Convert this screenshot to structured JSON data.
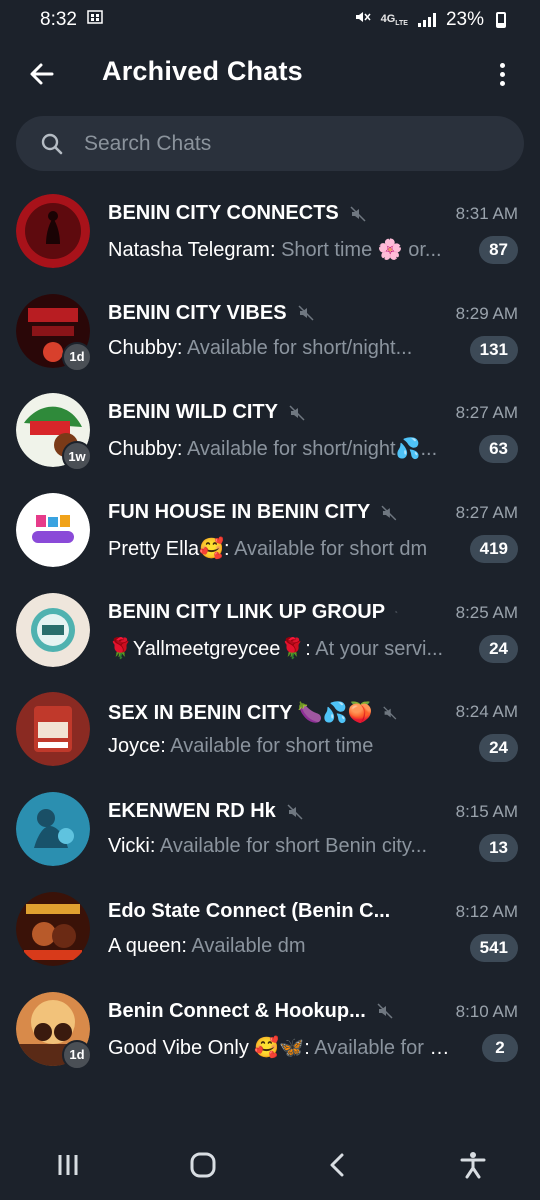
{
  "status_bar": {
    "time": "8:32",
    "network": "4G LTE",
    "battery": "23%"
  },
  "appbar": {
    "title": "Archived Chats",
    "back_icon": "arrow-left-icon",
    "menu_icon": "more-vertical-icon"
  },
  "search": {
    "placeholder": "Search Chats",
    "value": ""
  },
  "colors": {
    "background": "#1c222b",
    "search_bg": "#2a313c",
    "badge_bg": "#3d4a57",
    "muted_text": "#8b949e"
  },
  "chats": [
    {
      "name": "BENIN CITY CONNECTS",
      "time": "8:31 AM",
      "sender": "Natasha Telegram: ",
      "message": "Short time 🌸 or...",
      "count": "87",
      "avatar_badge": ""
    },
    {
      "name": "BENIN CITY VIBES",
      "time": "8:29 AM",
      "sender": "Chubby: ",
      "message": "Available for short/night...",
      "count": "131",
      "avatar_badge": "1d"
    },
    {
      "name": "BENIN WILD CITY",
      "time": "8:27 AM",
      "sender": "Chubby: ",
      "message": "Available for short/night💦...",
      "count": "63",
      "avatar_badge": "1w"
    },
    {
      "name": "FUN HOUSE IN BENIN CITY",
      "time": "8:27 AM",
      "sender": "Pretty Ella🥰: ",
      "message": "Available for short dm",
      "count": "419",
      "avatar_badge": ""
    },
    {
      "name": "BENIN CITY LINK UP GROUP",
      "time": "8:25 AM",
      "sender": "🌹Yallmeetgreycee🌹: ",
      "message": "At your servi...",
      "count": "24",
      "avatar_badge": ""
    },
    {
      "name": "SEX IN BENIN CITY 🍆💦🍑",
      "time": "8:24 AM",
      "sender": "Joyce: ",
      "message": "Available for short time",
      "count": "24",
      "avatar_badge": ""
    },
    {
      "name": "EKENWEN RD Hk",
      "time": "8:15 AM",
      "sender": "Vicki: ",
      "message": "Available for short  Benin city...",
      "count": "13",
      "avatar_badge": ""
    },
    {
      "name": "Edo State Connect (Benin C...",
      "time": "8:12 AM",
      "sender": "A queen: ",
      "message": "Available dm",
      "count": "541",
      "avatar_badge": ""
    },
    {
      "name": "Benin Connect & Hookup...",
      "time": "8:10 AM",
      "sender": "Good Vibe Only 🥰🦋: ",
      "message": "Available for S...",
      "count": "2",
      "avatar_badge": "1d"
    }
  ],
  "navbar": {
    "recents_icon": "recent-apps-icon",
    "home_icon": "home-icon",
    "back_icon": "back-icon",
    "accessibility_icon": "accessibility-icon"
  }
}
